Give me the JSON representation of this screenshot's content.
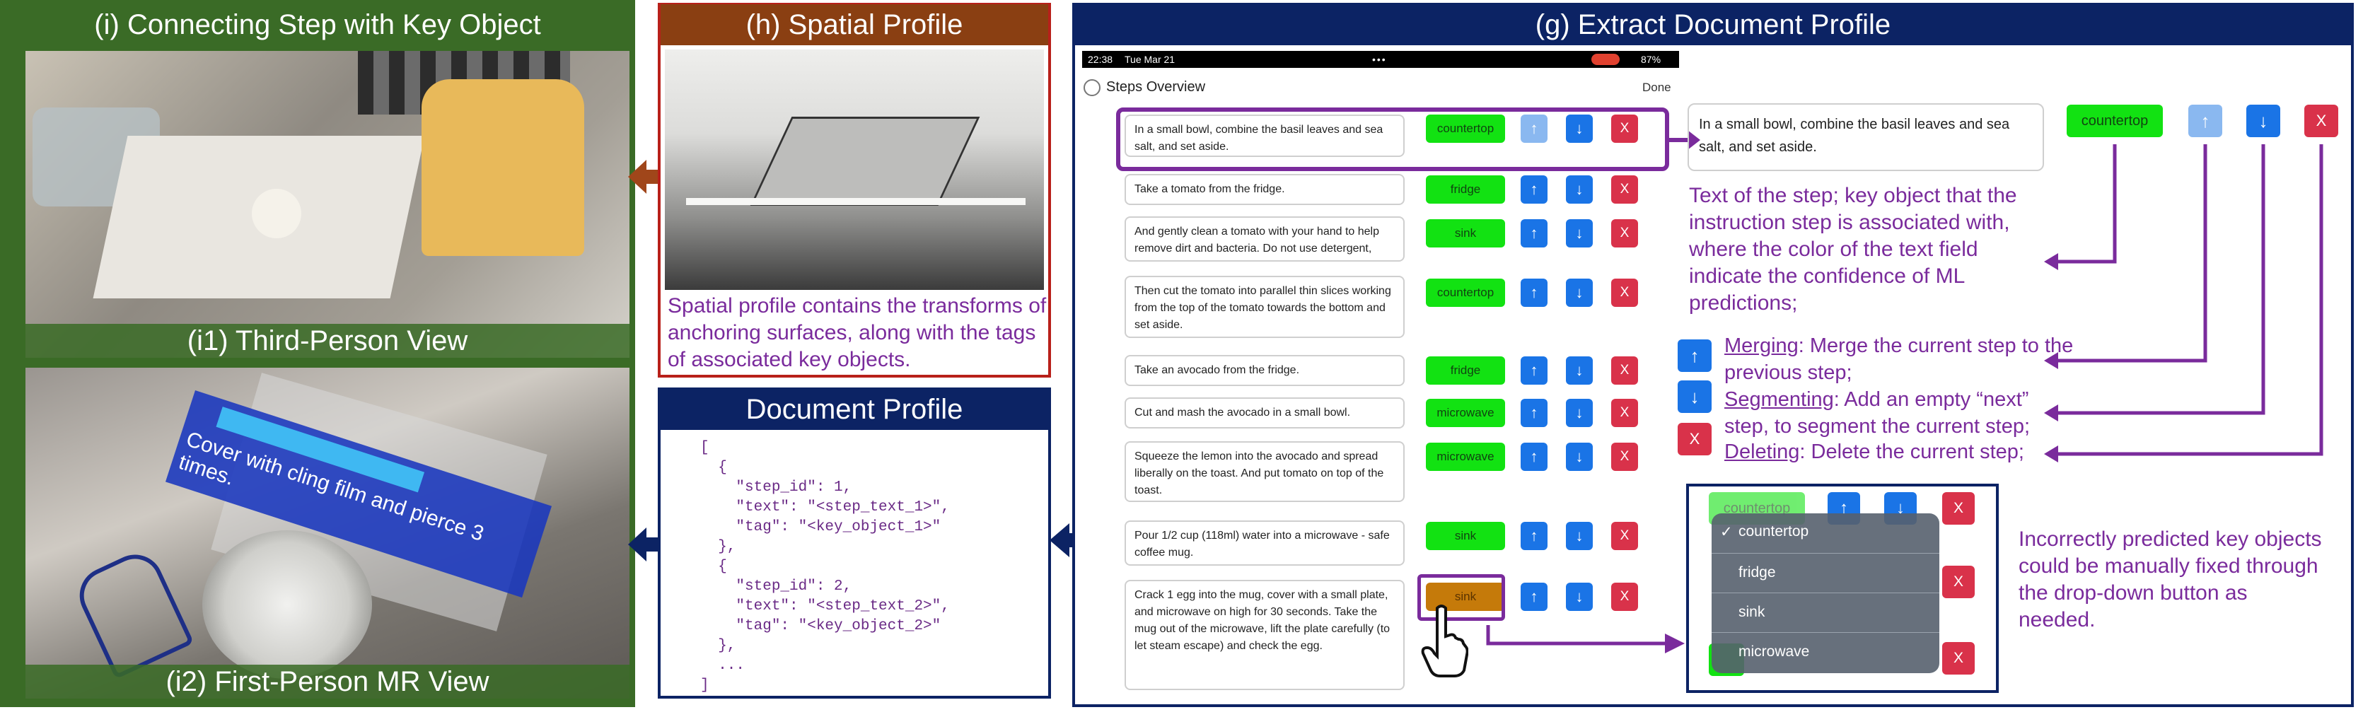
{
  "panel_i": {
    "title": "(i) Connecting Step with Key Object",
    "caption_top": "(i1) Third-Person View",
    "caption_bottom": "(i2) First-Person MR View",
    "mr_label": "Cover with cling film and pierce 3 times."
  },
  "panel_h": {
    "title": "(h) Spatial Profile",
    "description": "Spatial profile contains the transforms of anchoring surfaces, along with the tags of associated key objects."
  },
  "doc_profile": {
    "title": "Document Profile",
    "code": "[\n  {\n    \"step_id\": 1,\n    \"text\": \"<step_text_1>\",\n    \"tag\": \"<key_object_1>\"\n  },\n  {\n    \"step_id\": 2,\n    \"text\": \"<step_text_2>\",\n    \"tag\": \"<key_object_2>\"\n  },\n  ...\n]"
  },
  "panel_g": {
    "title": "(g) Extract Document Profile",
    "status_time": "22:38",
    "status_date": "Tue Mar 21",
    "status_battery": "87%",
    "overview_label": "Steps Overview",
    "done_label": "Done",
    "steps": [
      {
        "text": "In a small bowl, combine the basil leaves and sea salt, and set aside.",
        "tag": "countertop"
      },
      {
        "text": "Take a tomato from the fridge.",
        "tag": "fridge"
      },
      {
        "text": "And gently clean a tomato with your hand to help remove dirt and bacteria. Do not use detergent,",
        "tag": "sink"
      },
      {
        "text": "Then cut the tomato into parallel thin slices working from the top of the tomato towards the bottom and set aside.",
        "tag": "countertop"
      },
      {
        "text": "Take an avocado from the fridge.",
        "tag": "fridge"
      },
      {
        "text": "Cut and mash the avocado in a small bowl.",
        "tag": "microwave"
      },
      {
        "text": "Squeeze the lemon into the avocado and spread liberally on the toast. And put tomato on top of the toast.",
        "tag": "microwave"
      },
      {
        "text": "Pour 1/2 cup (118ml) water into a microwave - safe coffee mug.",
        "tag": "sink"
      },
      {
        "text": "Crack 1 egg into the mug, cover with a small plate, and microwave on high for 30 seconds. Take the mug out of the microwave, lift the plate carefully (to let steam escape) and check the egg.",
        "tag": "sink"
      }
    ],
    "zoom_text": "In a small bowl, combine the basil leaves and sea salt, and set aside.",
    "zoom_tag": "countertop",
    "text_desc": "Text of the step; key object that the instruction step is associated with, where the color of the text field indicate the confidence of ML predictions;",
    "merge_term": "Merging",
    "merge_desc": ": Merge the current step to the previous step;",
    "segment_term": "Segmenting",
    "segment_desc": ": Add an empty “next” step, to segment the current step;",
    "delete_term": "Deleting",
    "delete_desc": ": Delete the current step;",
    "dropdown_selected": "countertop",
    "dropdown_options": [
      "countertop",
      "fridge",
      "sink",
      "microwave"
    ],
    "dropdown_desc": "Incorrectly predicted key objects could be manually fixed through the drop-down button as needed.",
    "up_symbol": "↑",
    "down_symbol": "↓",
    "delete_symbol": "X",
    "check_symbol": "✓"
  },
  "colors": {
    "green_panel": "#3a6b26",
    "brown_panel": "#8a3f12",
    "navy_panel": "#0c2364",
    "purple_accent": "#7a2b9c",
    "tag_green": "#12e212",
    "tag_low_confidence": "#c57a0a",
    "button_blue": "#1a74e6",
    "button_red": "#d9324a"
  },
  "icons": [
    "pointer-hand-icon",
    "arrow-left-icon",
    "arrow-right-icon",
    "checkmark-icon"
  ]
}
